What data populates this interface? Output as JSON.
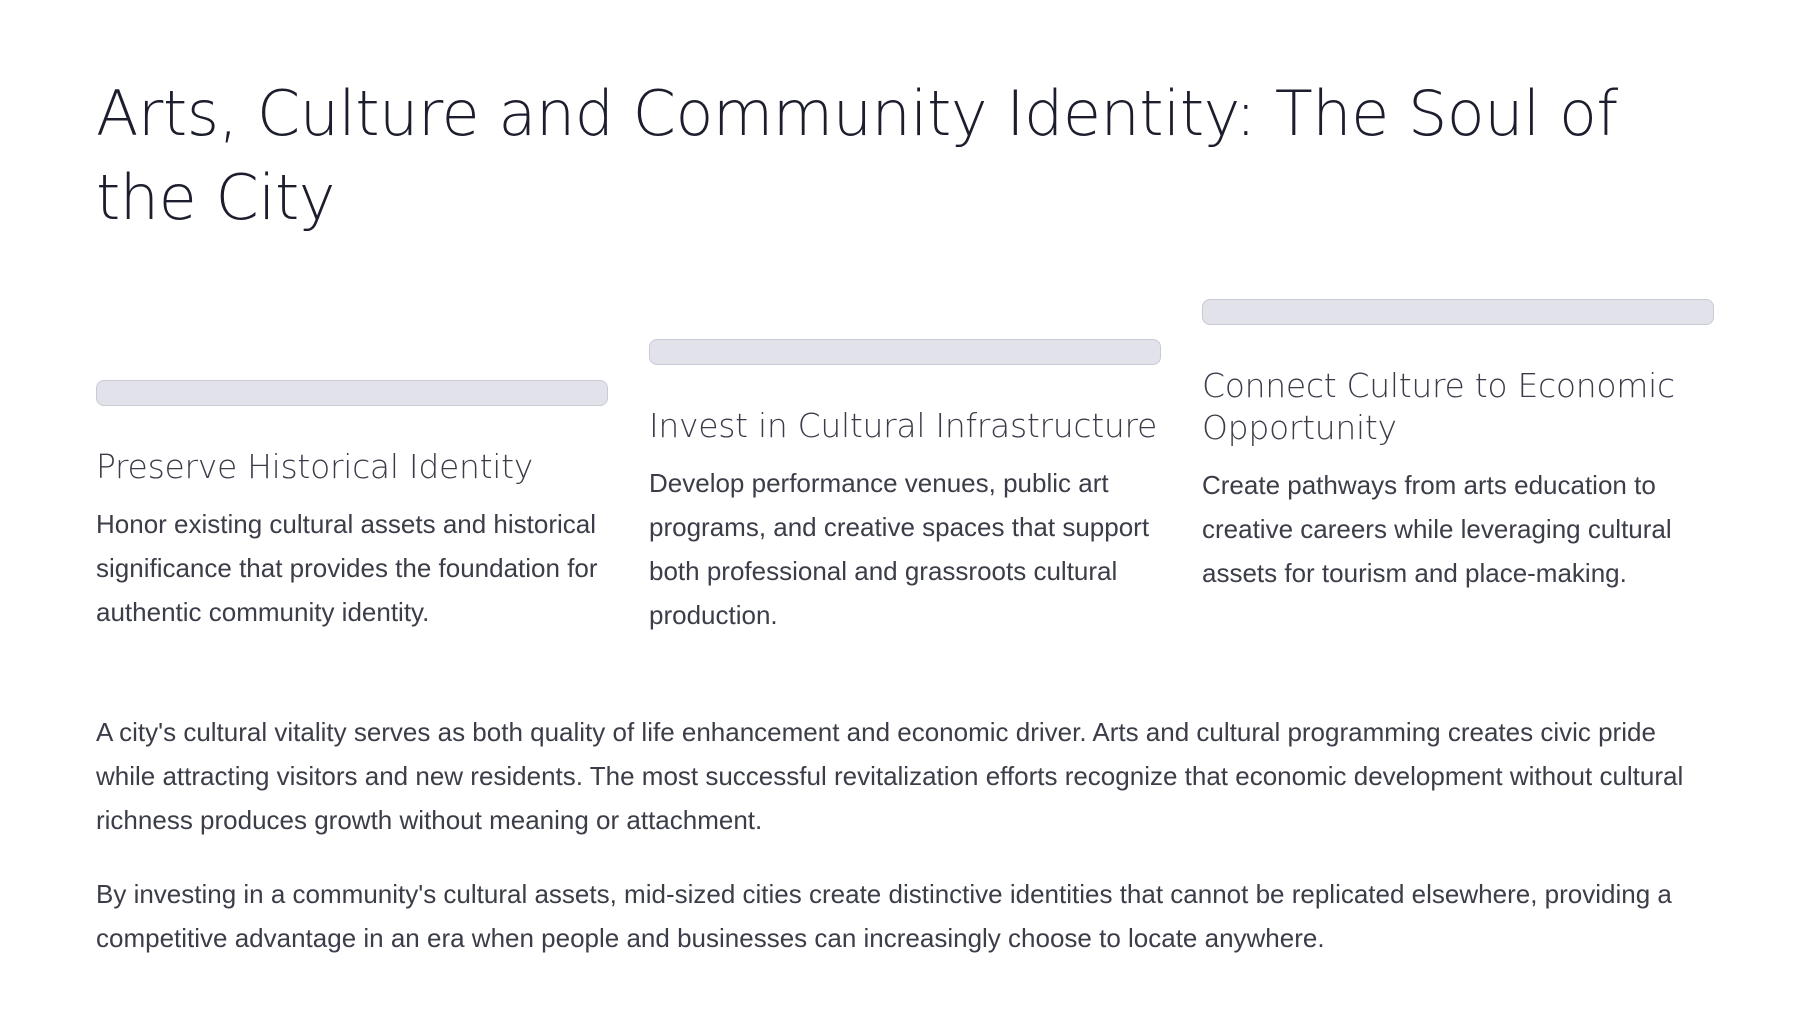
{
  "title": "Arts, Culture and Community Identity: The Soul of the City",
  "columns": [
    {
      "heading": "Preserve Historical Identity",
      "text": "Honor existing cultural assets and historical significance that provides the foundation for authentic community identity."
    },
    {
      "heading": "Invest in Cultural Infrastructure",
      "text": "Develop performance venues, public art programs, and creative spaces that support both professional and grassroots cultural production."
    },
    {
      "heading": "Connect Culture to Economic Opportunity",
      "text": "Create pathways from arts education to creative careers while leveraging cultural assets for tourism and place-making."
    }
  ],
  "paragraphs": [
    "A city's cultural vitality serves as both quality of life enhancement and economic driver. Arts and cultural programming creates civic pride while attracting visitors and new residents. The most successful revitalization efforts recognize that economic development without cultural richness produces growth without meaning or attachment.",
    "By investing in a community's cultural assets, mid-sized cities create distinctive identities that cannot be replicated elsewhere, providing a competitive advantage in an era when people and businesses can increasingly choose to locate anywhere."
  ],
  "colors": {
    "title": "#1c1e2e",
    "text": "#3b3d48",
    "bar_fill": "#e2e3ea",
    "bar_border": "#c9cad3"
  }
}
